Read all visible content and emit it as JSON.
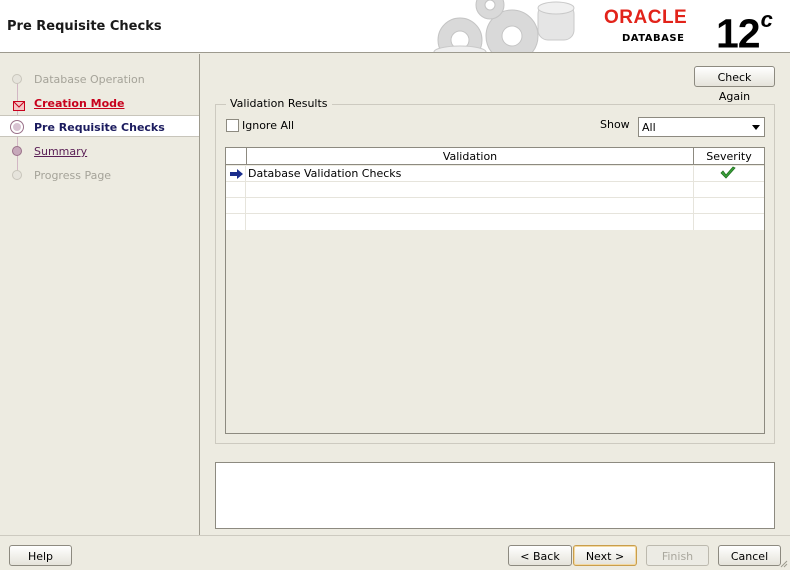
{
  "header": {
    "title": "Pre Requisite Checks",
    "logo": {
      "brand": "ORACLE",
      "product": "DATABASE",
      "version": "12",
      "version_suffix": "c"
    }
  },
  "sidebar": {
    "steps": [
      {
        "label": "Database Operation",
        "state": "disabled"
      },
      {
        "label": "Creation Mode",
        "state": "error"
      },
      {
        "label": "Pre Requisite Checks",
        "state": "current"
      },
      {
        "label": "Summary",
        "state": "link"
      },
      {
        "label": "Progress Page",
        "state": "disabled"
      }
    ]
  },
  "main": {
    "check_again_label": "Check Again",
    "group_title": "Validation Results",
    "ignore_all_label": "Ignore All",
    "show_label": "Show",
    "show_value": "All",
    "table": {
      "columns": [
        "Validation",
        "Severity"
      ],
      "rows": [
        {
          "validation": "Database Validation Checks",
          "severity_icon": "green-checkmark-icon"
        }
      ]
    }
  },
  "footer": {
    "help_label": "Help",
    "back_label": "< Back",
    "next_label": "Next >",
    "finish_label": "Finish",
    "cancel_label": "Cancel"
  },
  "colors": {
    "background": "#edebe1",
    "oracle_red": "#e2231a",
    "error_link": "#c8001c",
    "visited_link": "#5a1e55",
    "check_green": "#3aa23a"
  }
}
